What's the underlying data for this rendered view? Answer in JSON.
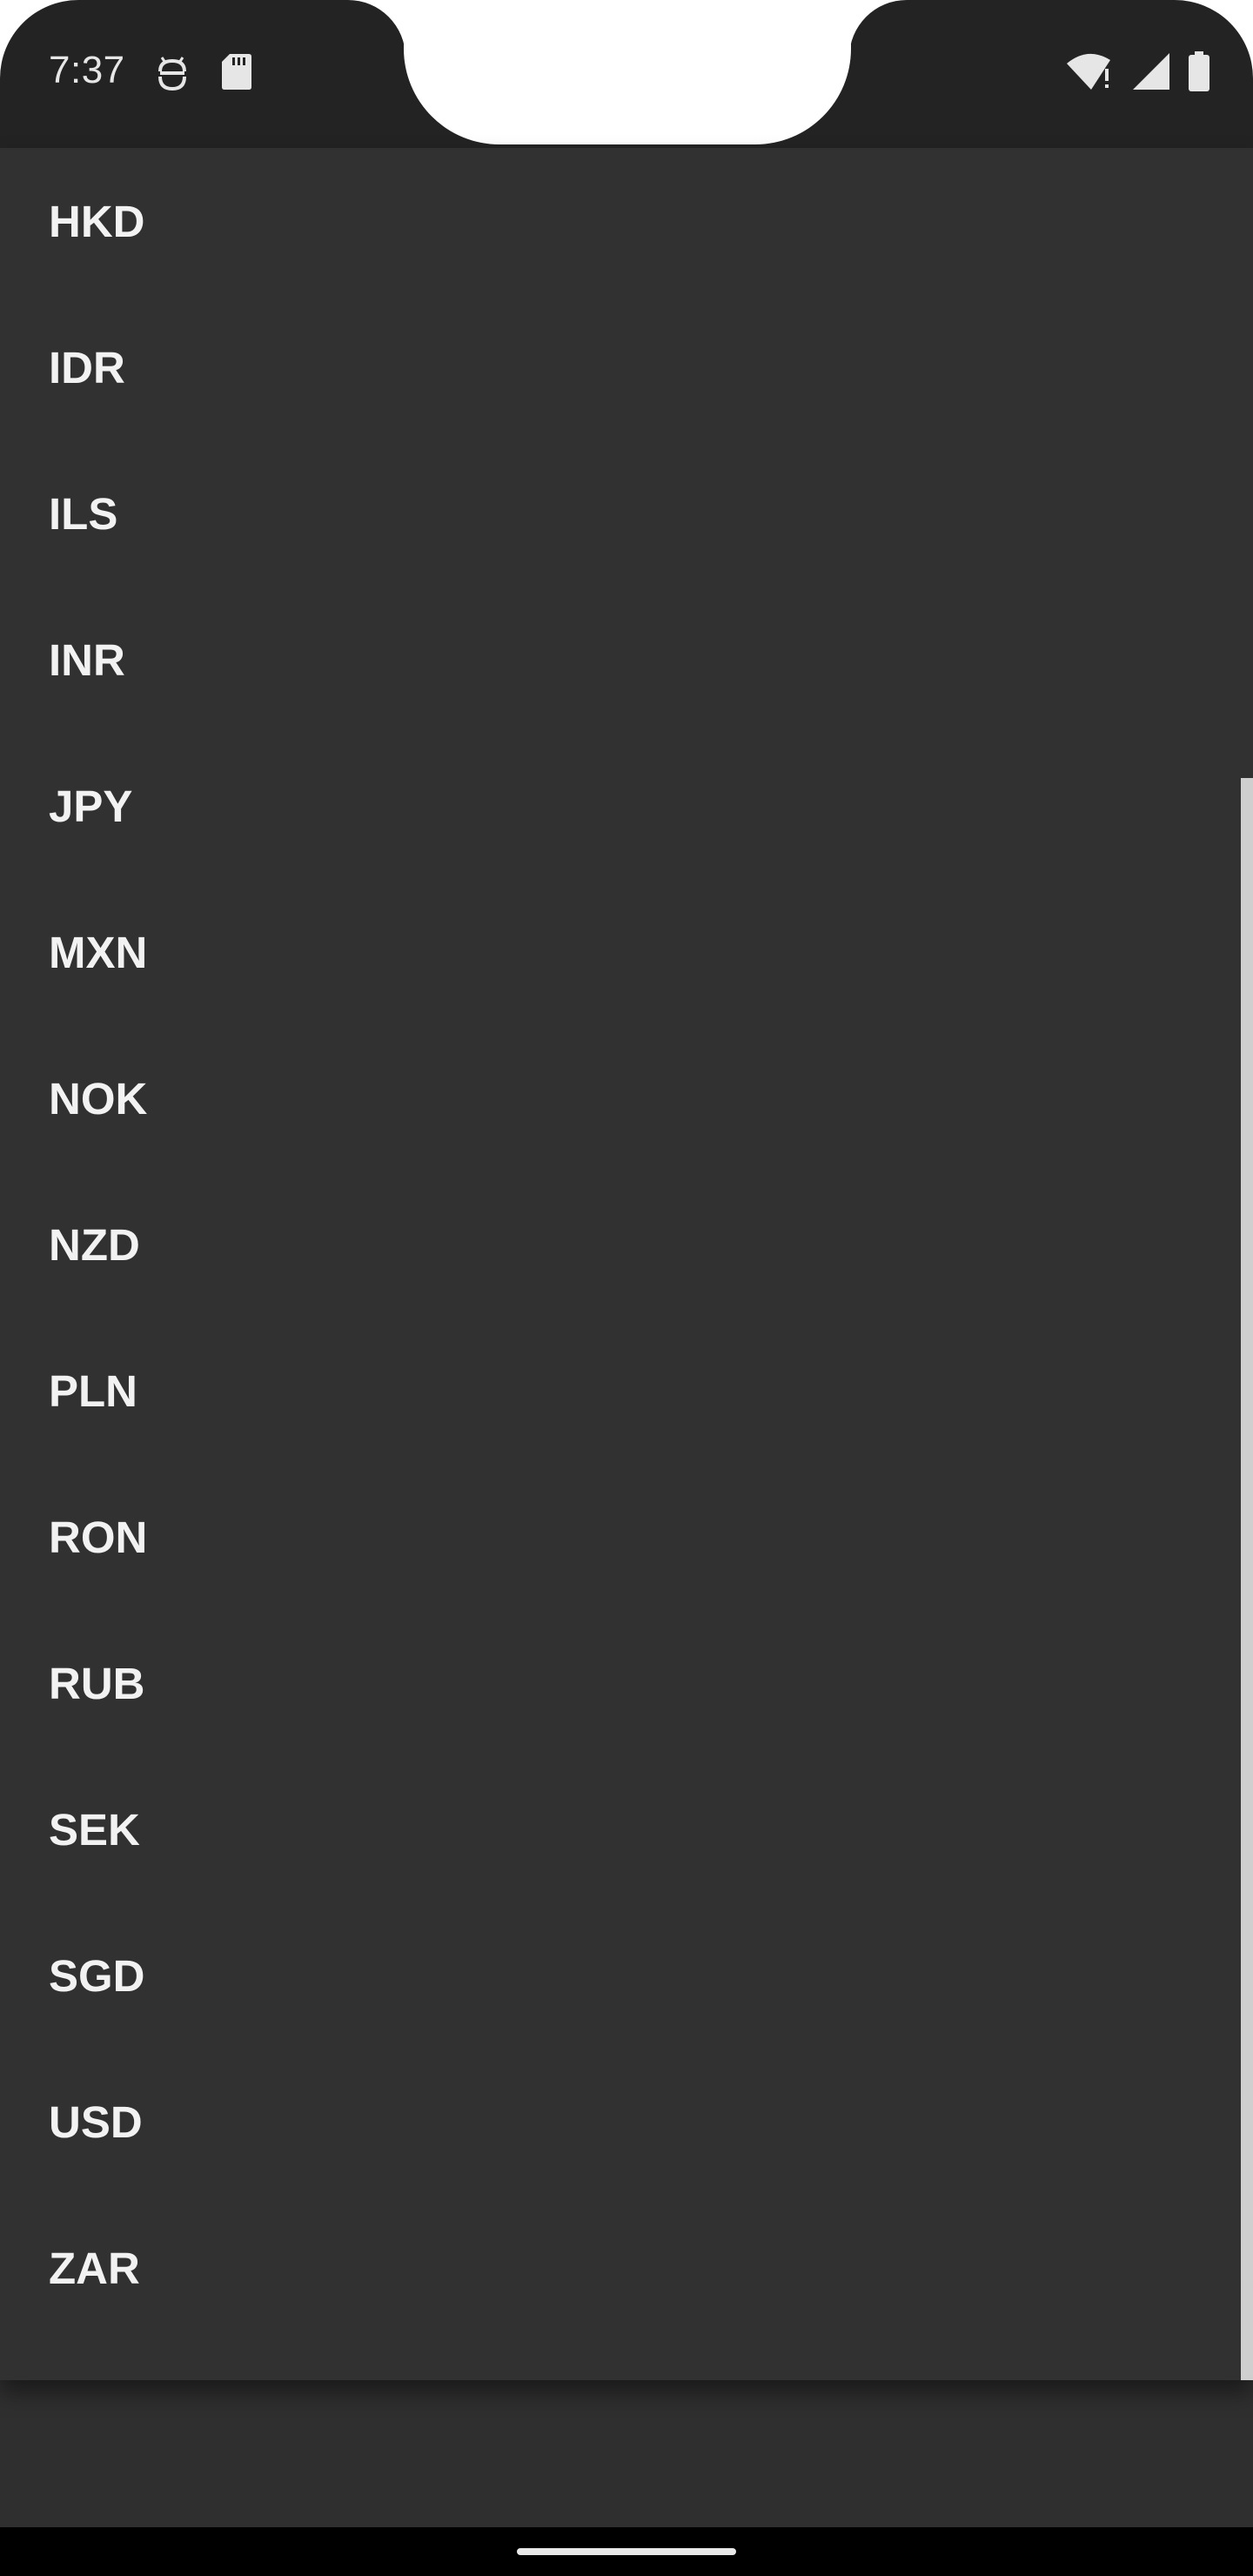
{
  "status_bar": {
    "time": "7:37",
    "left_icons": [
      "android-debug-icon",
      "sd-card-icon"
    ],
    "right_icons": [
      "wifi-alert-icon",
      "cell-signal-icon",
      "battery-icon"
    ]
  },
  "currency_list": {
    "items": [
      {
        "code": "HKD"
      },
      {
        "code": "IDR"
      },
      {
        "code": "ILS"
      },
      {
        "code": "INR"
      },
      {
        "code": "JPY"
      },
      {
        "code": "MXN"
      },
      {
        "code": "NOK"
      },
      {
        "code": "NZD"
      },
      {
        "code": "PLN"
      },
      {
        "code": "RON"
      },
      {
        "code": "RUB"
      },
      {
        "code": "SEK"
      },
      {
        "code": "SGD"
      },
      {
        "code": "USD"
      },
      {
        "code": "ZAR"
      }
    ]
  },
  "colors": {
    "background": "#2f2f2f",
    "popup": "#313131",
    "text": "#f2f2f2",
    "scrollbar": "#cfcfcf",
    "status_bar": "#232323"
  }
}
